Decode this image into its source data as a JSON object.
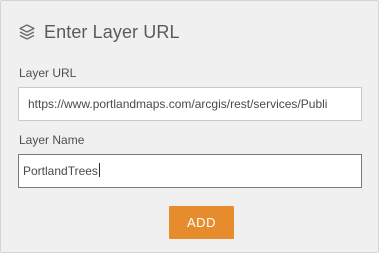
{
  "dialog": {
    "title": "Enter Layer URL",
    "icon": "layers-icon"
  },
  "fields": {
    "url": {
      "label": "Layer URL",
      "value": "https://www.portlandmaps.com/arcgis/rest/services/Publi"
    },
    "name": {
      "label": "Layer Name",
      "value": "PortlandTrees"
    }
  },
  "actions": {
    "add_label": "ADD"
  },
  "colors": {
    "accent": "#e78c2d",
    "panel_bg": "#f0f0f0"
  }
}
